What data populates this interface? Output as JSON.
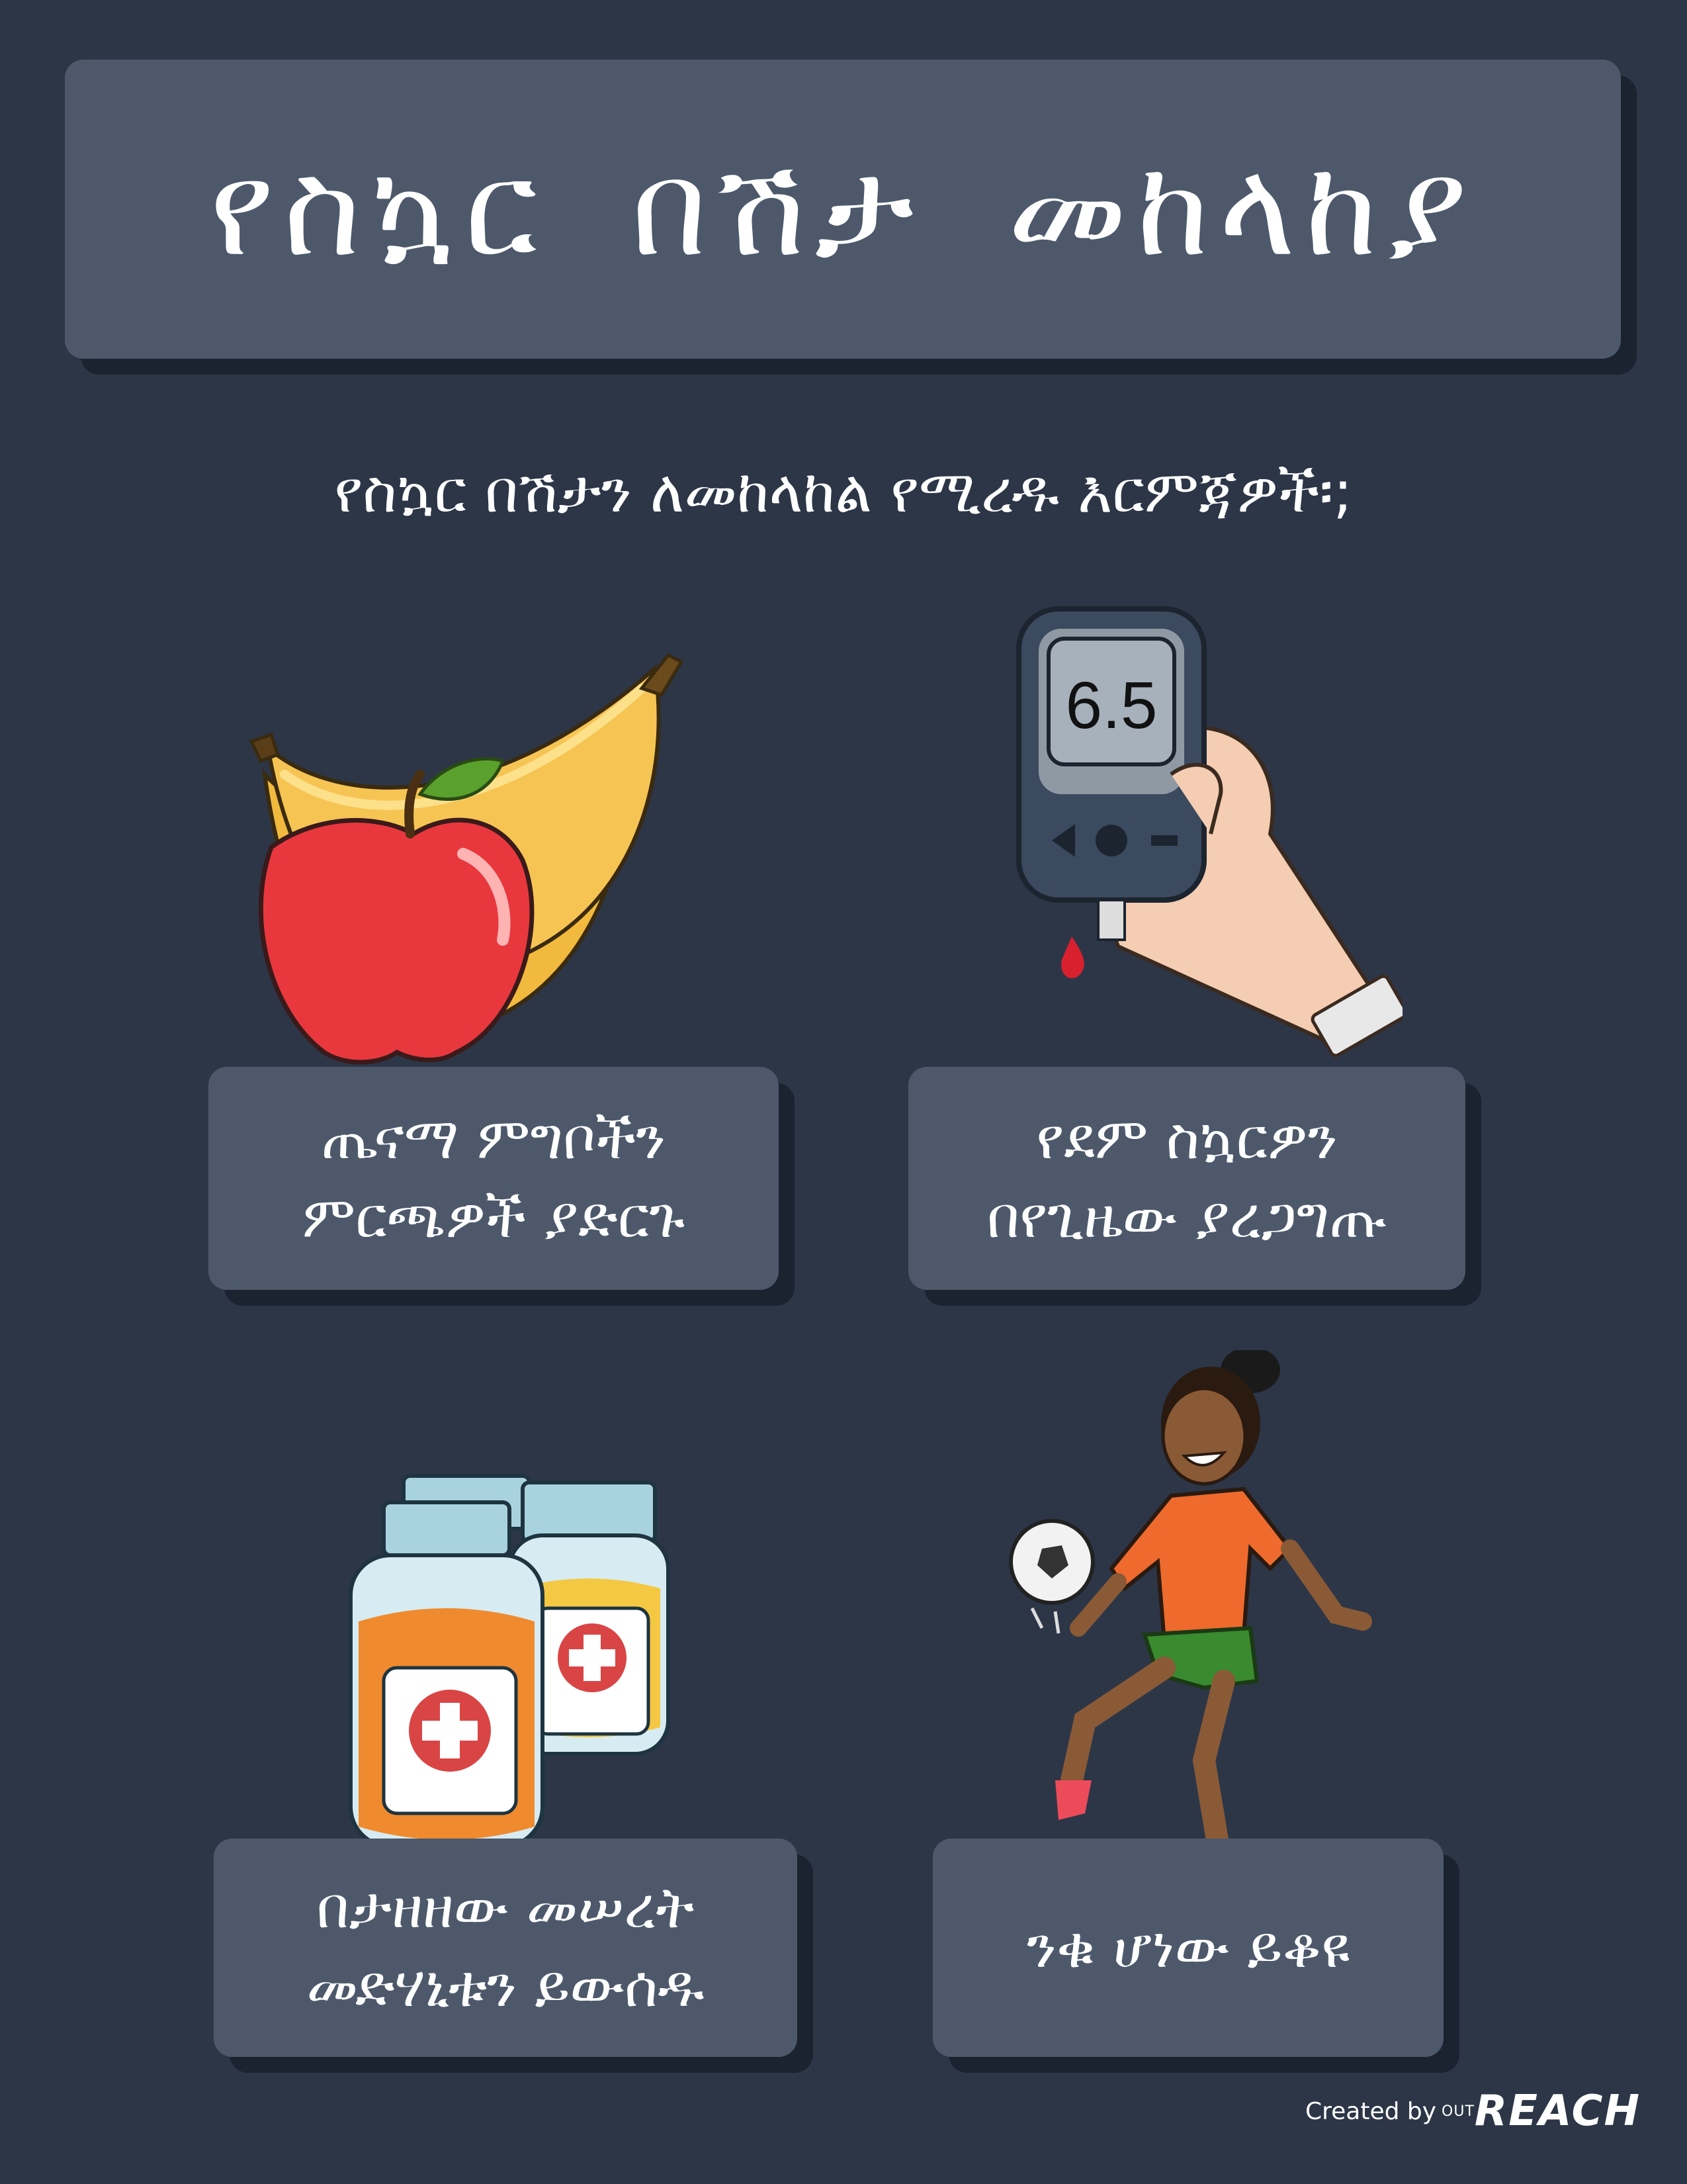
{
  "title": "የስኳር በሽታ መከላከያ",
  "subtitle": "የስኳር በሽታን ለመከላከል የሚረዱ እርምጃዎች፡;",
  "meter_reading": "6.5",
  "cards": [
    {
      "line1": "ጤናማ ምግቦችን",
      "line2": "ምርጫዎች ያድርጉ",
      "icon": "fruit-icon"
    },
    {
      "line1": "የደም ስኳርዎን",
      "line2": "በየጊዜው ያረጋግጡ",
      "icon": "glucose-meter-icon"
    },
    {
      "line1": "በታዘዘው መሠረት",
      "line2": "መድሃኒቱን ይውሰዱ",
      "icon": "medicine-bottles-icon"
    },
    {
      "line1": "ንቁ ሆነው ይቆዩ",
      "line2": "",
      "icon": "active-woman-icon"
    }
  ],
  "credit": {
    "text": "Created by",
    "small": "OUT",
    "brand": "REACH"
  },
  "colors": {
    "background": "#2c3647",
    "box": "#4d596b",
    "shadow": "#1b2230",
    "banana": "#f6c453",
    "apple": "#e8383d",
    "jersey": "#ee6a2d",
    "shorts": "#3a8a2f"
  }
}
